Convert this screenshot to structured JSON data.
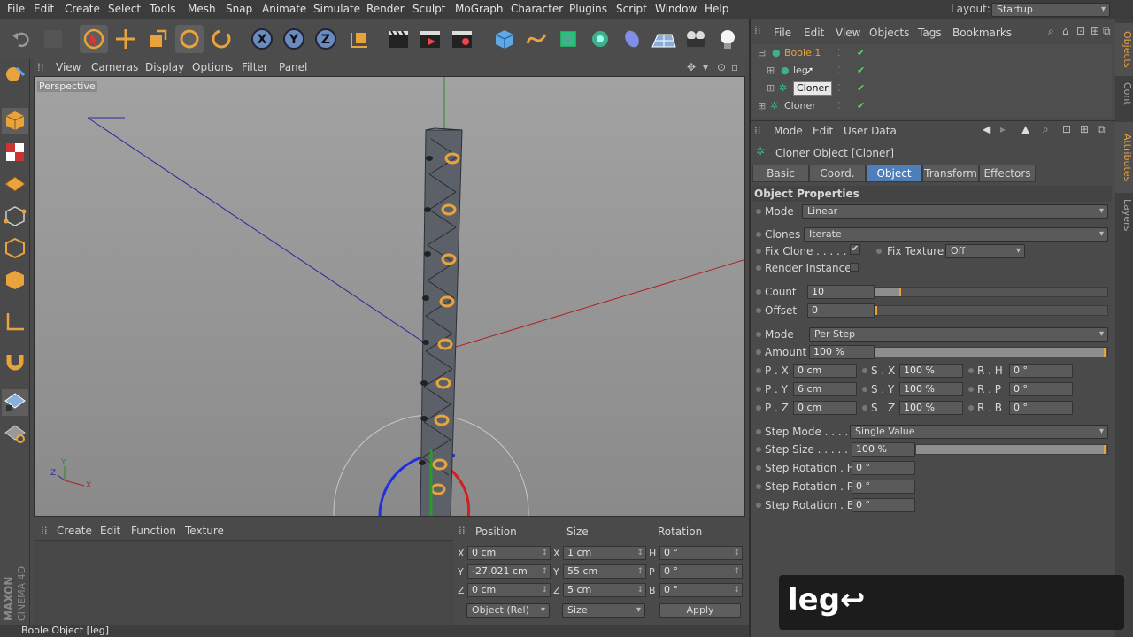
{
  "menubar": {
    "items": [
      "File",
      "Edit",
      "Create",
      "Select",
      "Tools",
      "Mesh",
      "Snap",
      "Animate",
      "Simulate",
      "Render",
      "Sculpt",
      "MoGraph",
      "Character",
      "Plugins",
      "Script",
      "Window",
      "Help"
    ],
    "layout_label": "Layout:",
    "layout_value": "Startup"
  },
  "viewport": {
    "menu": [
      "View",
      "Cameras",
      "Display",
      "Options",
      "Filter",
      "Panel"
    ],
    "label": "Perspective",
    "axis_x": "X",
    "axis_y": "Y",
    "axis_z": "Z"
  },
  "material": {
    "menu": [
      "Create",
      "Edit",
      "Function",
      "Texture"
    ]
  },
  "coords": {
    "headers": [
      "Position",
      "Size",
      "Rotation"
    ],
    "rows": [
      {
        "axis": "X",
        "pos": "0 cm",
        "size_axis": "X",
        "size": "1 cm",
        "rot_axis": "H",
        "rot": "0 °"
      },
      {
        "axis": "Y",
        "pos": "-27.021 cm",
        "size_axis": "Y",
        "size": "55 cm",
        "rot_axis": "P",
        "rot": "0 °"
      },
      {
        "axis": "Z",
        "pos": "0 cm",
        "size_axis": "Z",
        "size": "5 cm",
        "rot_axis": "B",
        "rot": "0 °"
      }
    ],
    "mode_select": "Object (Rel)",
    "size_select": "Size",
    "apply_label": "Apply"
  },
  "status": {
    "text": "Boole Object [leg]"
  },
  "brand": {
    "maxon": "MAXON",
    "cinema": "CINEMA 4D"
  },
  "object_manager": {
    "menu": [
      "File",
      "Edit",
      "View",
      "Objects",
      "Tags",
      "Bookmarks"
    ],
    "objects": [
      {
        "name": "Boole.1",
        "indent": 0,
        "color": "#e8a33c"
      },
      {
        "name": "leg",
        "indent": 1,
        "color": "#d6d6d6"
      },
      {
        "name": "Cloner",
        "indent": 1,
        "color": "#d6d6d6"
      },
      {
        "name": "Cloner",
        "indent": 0,
        "color": "#d6d6d6"
      }
    ]
  },
  "attributes": {
    "menu": [
      "Mode",
      "Edit",
      "User Data"
    ],
    "title": "Cloner Object [Cloner]",
    "tabs": [
      "Basic",
      "Coord.",
      "Object",
      "Transform",
      "Effectors"
    ],
    "active_tab": "Object",
    "section": "Object Properties",
    "mode_label": "Mode",
    "mode_value": "Linear",
    "clones_label": "Clones",
    "clones_value": "Iterate",
    "fix_clone_label": "Fix Clone . . . . . .",
    "fix_clone_checked": true,
    "fix_texture_label": "Fix Texture",
    "fix_texture_value": "Off",
    "render_instances_label": "Render Instances",
    "render_instances_checked": false,
    "count_label": "Count",
    "count_value": "10",
    "count_fill": 0.12,
    "offset_label": "Offset",
    "offset_value": "0",
    "offset_fill": 0.0,
    "mode2_label": "Mode",
    "mode2_value": "Per Step",
    "amount_label": "Amount",
    "amount_value": "100 %",
    "amount_fill": 1.0,
    "transform_rows": [
      {
        "p_label": "P . X",
        "p_val": "0 cm",
        "s_label": "S . X",
        "s_val": "100 %",
        "r_label": "R . H",
        "r_val": "0 °"
      },
      {
        "p_label": "P . Y",
        "p_val": "6 cm",
        "s_label": "S . Y",
        "s_val": "100 %",
        "r_label": "R . P",
        "r_val": "0 °"
      },
      {
        "p_label": "P . Z",
        "p_val": "0 cm",
        "s_label": "S . Z",
        "s_val": "100 %",
        "r_label": "R . B",
        "r_val": "0 °"
      }
    ],
    "step_mode_label": "Step Mode . . . . . .",
    "step_mode_value": "Single Value",
    "step_size_label": "Step Size . . . . . . .",
    "step_size_value": "100 %",
    "step_size_fill": 1.0,
    "step_rot": [
      {
        "label": "Step Rotation . H",
        "val": "0 °"
      },
      {
        "label": "Step Rotation . P",
        "val": "0 °"
      },
      {
        "label": "Step Rotation . B",
        "val": "0 °"
      }
    ]
  },
  "side_tabs": [
    "Objects",
    "Cont",
    "Attributes",
    "Layers"
  ],
  "overlay": {
    "text": "leg↩"
  },
  "colors": {
    "accent": "#4f7fb8",
    "orange": "#e8a33c"
  }
}
